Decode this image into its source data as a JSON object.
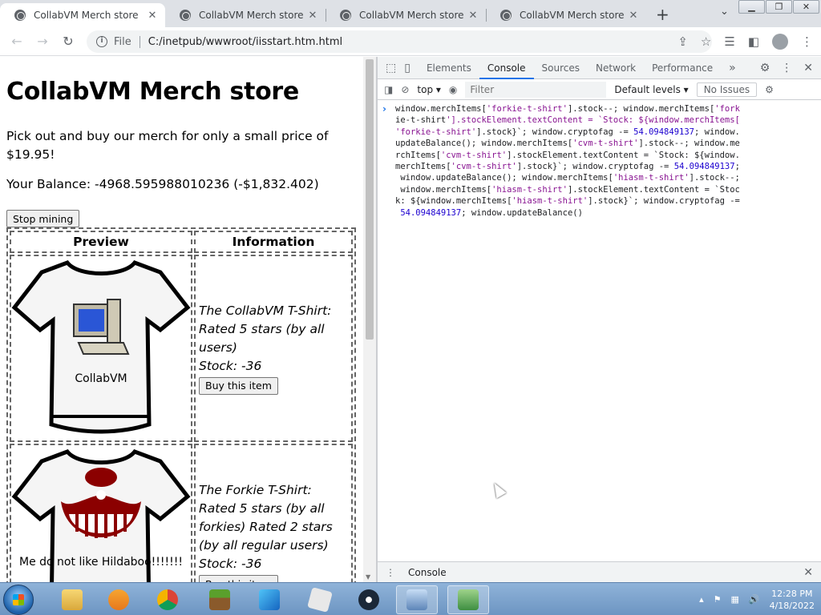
{
  "browser": {
    "tabs": [
      {
        "title": "CollabVM Merch store",
        "active": true
      },
      {
        "title": "CollabVM Merch store",
        "active": false
      },
      {
        "title": "CollabVM Merch store",
        "active": false
      },
      {
        "title": "CollabVM Merch store",
        "active": false
      }
    ],
    "new_tab_glyph": "+",
    "window_buttons": [
      "▁",
      "❐",
      "✕"
    ],
    "file_label": "File",
    "url": "C:/inetpub/wwwroot/iisstart.htm.html"
  },
  "page": {
    "title": "CollabVM Merch store",
    "intro": "Pick out and buy our merch for only a small price of $19.95!",
    "balance": "Your Balance: -4968.595988010236 (-$1,832.402)",
    "mining_button": "Stop mining",
    "table": {
      "headers": [
        "Preview",
        "Information"
      ],
      "rows": [
        {
          "caption": "CollabVM",
          "info_lines": [
            "The CollabVM T-Shirt:",
            "Rated 5 stars (by all",
            "users)",
            "Stock: -36"
          ],
          "buy_label": "Buy this item"
        },
        {
          "caption": "Me do not like Hildaboo!!!!!!!",
          "info_lines": [
            "The Forkie T-Shirt:",
            "Rated 5 stars (by all",
            "forkies) Rated 2 stars",
            "(by all regular users)",
            "Stock: -36"
          ],
          "buy_label": "Buy this item"
        }
      ]
    }
  },
  "devtools": {
    "tabs": [
      "Elements",
      "Console",
      "Sources",
      "Network",
      "Performance"
    ],
    "active_tab": "Console",
    "context": "top",
    "filter_placeholder": "Filter",
    "levels": "Default levels",
    "issues": "No Issues",
    "drawer_tab": "Console",
    "console_input": "window.merchItems['forkie-t-shirt'].stock--; window.merchItems['forkie-t-shirt'].stockElement.textContent = `Stock: ${window.merchItems['forkie-t-shirt'].stock}`; window.cryptofag -= 54.094849137; window.updateBalance(); window.merchItems['cvm-t-shirt'].stock--; window.merchItems['cvm-t-shirt'].stockElement.textContent = `Stock: ${window.merchItems['cvm-t-shirt'].stock}`; window.cryptofag -= 54.094849137; window.updateBalance(); window.merchItems['hiasm-t-shirt'].stock--; window.merchItems['hiasm-t-shirt'].stockElement.textContent = `Stock: ${window.merchItems['hiasm-t-shirt'].stock}`; window.cryptofag -= 54.094849137; window.updateBalance()"
  },
  "taskbar": {
    "time": "12:28 PM",
    "date": "4/18/2022",
    "apps": [
      "file-explorer",
      "media-player",
      "chrome",
      "minecraft",
      "app-blue",
      "roblox",
      "steam",
      "task-app",
      "control-panel"
    ]
  }
}
